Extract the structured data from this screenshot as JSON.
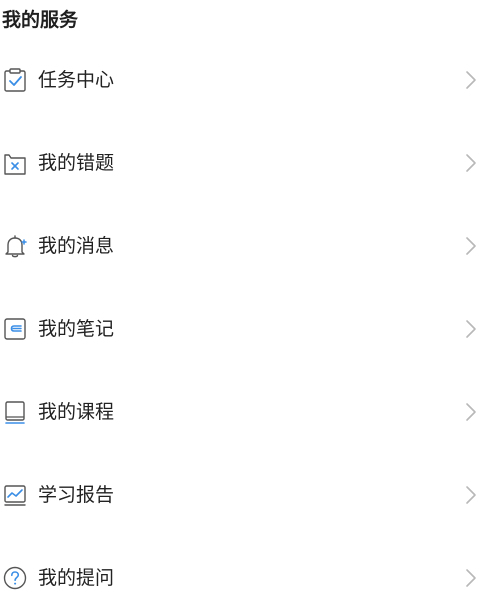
{
  "section": {
    "title": "我的服务"
  },
  "colors": {
    "icon_stroke": "#555555",
    "icon_accent": "#3a8ee6",
    "chevron": "#b8b8b8",
    "text": "#222222"
  },
  "menu": {
    "items": [
      {
        "label": "任务中心",
        "icon": "task-clipboard-check-icon"
      },
      {
        "label": "我的错题",
        "icon": "wrong-question-icon"
      },
      {
        "label": "我的消息",
        "icon": "bell-icon"
      },
      {
        "label": "我的笔记",
        "icon": "note-icon"
      },
      {
        "label": "我的课程",
        "icon": "course-book-icon"
      },
      {
        "label": "学习报告",
        "icon": "report-chart-icon"
      },
      {
        "label": "我的提问",
        "icon": "question-circle-icon"
      }
    ]
  }
}
